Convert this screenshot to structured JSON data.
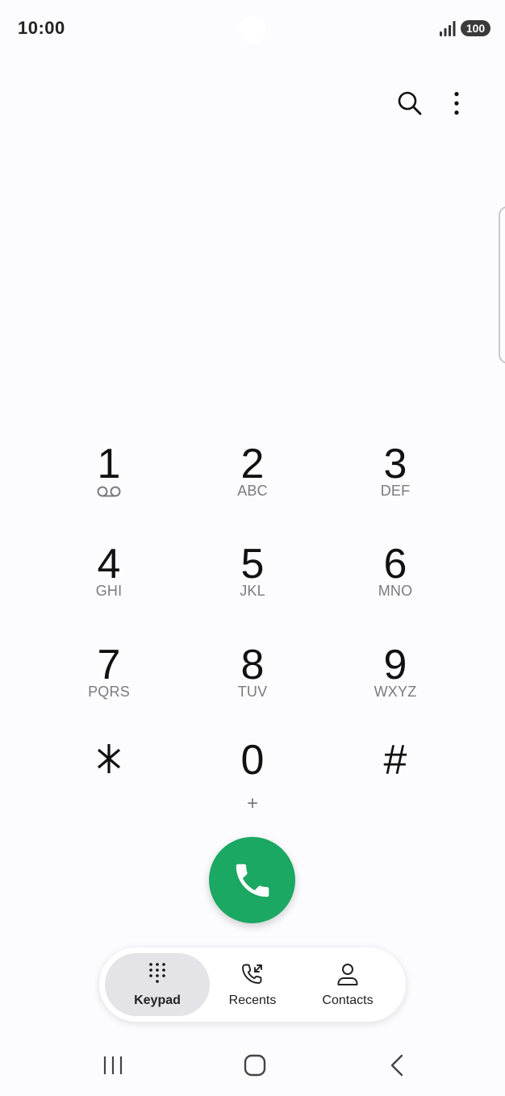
{
  "status_bar": {
    "time": "10:00",
    "battery": "100",
    "signal_icon": "signal-bars-icon"
  },
  "top_actions": {
    "search_icon": "search-icon",
    "more_icon": "more-vert-icon"
  },
  "keypad": {
    "keys": [
      {
        "digit": "1",
        "letters": "",
        "sub_icon": "voicemail-icon"
      },
      {
        "digit": "2",
        "letters": "ABC"
      },
      {
        "digit": "3",
        "letters": "DEF"
      },
      {
        "digit": "4",
        "letters": "GHI"
      },
      {
        "digit": "5",
        "letters": "JKL"
      },
      {
        "digit": "6",
        "letters": "MNO"
      },
      {
        "digit": "7",
        "letters": "PQRS"
      },
      {
        "digit": "8",
        "letters": "TUV"
      },
      {
        "digit": "9",
        "letters": "WXYZ"
      },
      {
        "digit": "*",
        "letters": ""
      },
      {
        "digit": "0",
        "letters": "",
        "extra": "+"
      },
      {
        "digit": "#",
        "letters": ""
      }
    ]
  },
  "call": {
    "icon": "phone-icon",
    "color": "#1ba862"
  },
  "tabs": [
    {
      "label": "Keypad",
      "icon": "dialpad-icon",
      "active": true
    },
    {
      "label": "Recents",
      "icon": "recent-calls-icon",
      "active": false
    },
    {
      "label": "Contacts",
      "icon": "person-icon",
      "active": false
    }
  ],
  "nav_bar": {
    "recents_icon": "recent-apps-icon",
    "home_icon": "home-icon",
    "back_icon": "back-icon"
  }
}
